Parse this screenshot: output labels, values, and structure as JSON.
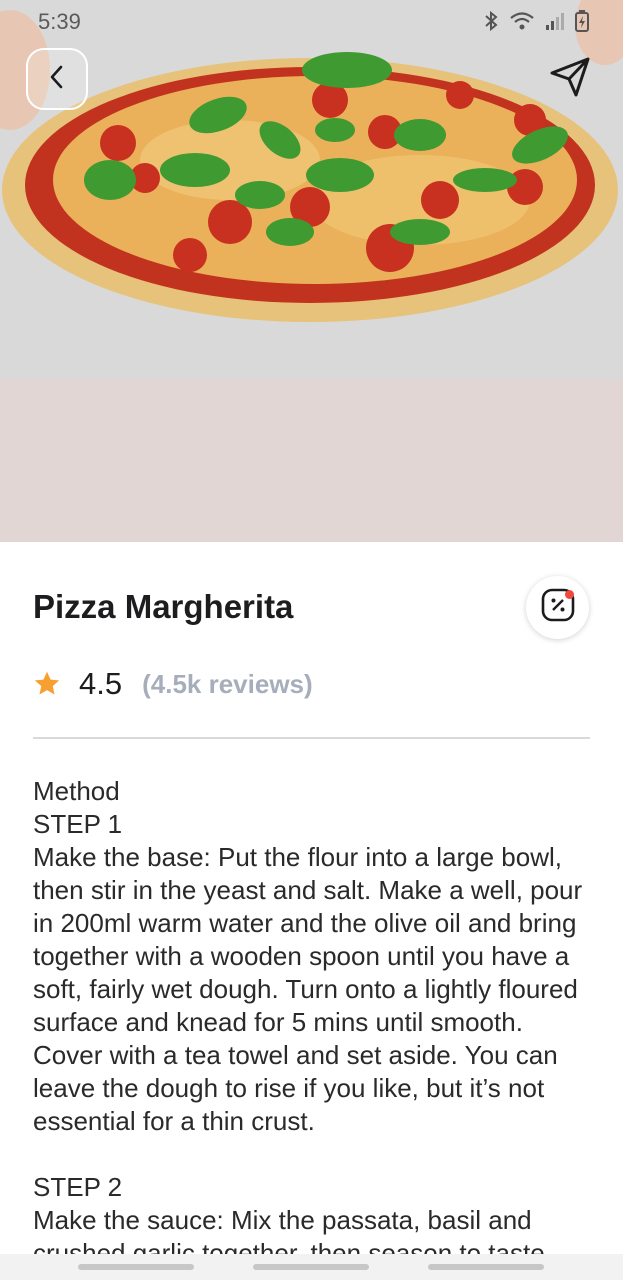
{
  "status_bar": {
    "time": "5:39",
    "icons": [
      "bluetooth-icon",
      "wifi-icon",
      "signal-icon",
      "battery-charging-icon"
    ]
  },
  "header": {
    "back_icon": "chevron-left-icon",
    "share_icon": "send-icon"
  },
  "recipe": {
    "title": "Pizza Margherita",
    "rating": "4.5",
    "reviews": "(4.5k reviews)",
    "discount_icon": "discount-percent-icon"
  },
  "method": {
    "heading": "Method",
    "step1_label": "STEP 1",
    "step1_text": "Make the base: Put the flour into a large bowl, then stir in the yeast and salt. Make a well, pour in 200ml warm water and the olive oil and bring together with a wooden spoon until you have a soft, fairly wet dough. Turn onto a lightly floured surface and knead for 5 mins until smooth. Cover with a tea towel and set aside. You can leave the dough to rise if you like, but it’s not essential for a thin crust.",
    "step2_label": "STEP 2",
    "step2_text": "Make the sauce: Mix the passata, basil and crushed garlic together, then season to taste."
  },
  "colors": {
    "star": "#f7a031",
    "reviews": "#a7aebb",
    "notification_dot": "#f04a3e"
  }
}
